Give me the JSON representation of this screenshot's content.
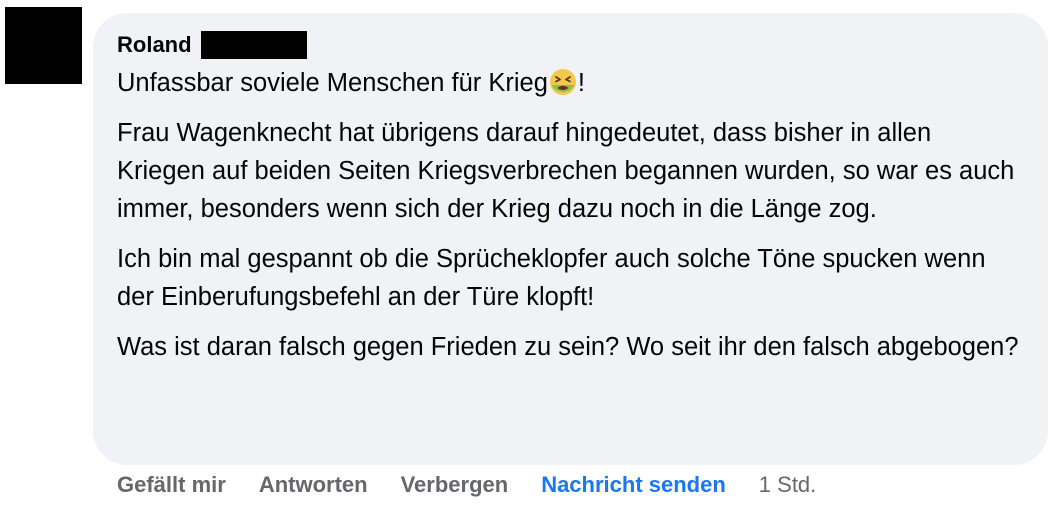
{
  "comment": {
    "author": "Roland",
    "paragraphs": [
      {
        "before_emoji": "Unfassbar soviele Menschen für Krieg",
        "emoji": "nauseated-face-emoji",
        "after_emoji": "!"
      },
      {
        "text": "Frau Wagenknecht hat übrigens darauf hingedeutet, dass bisher in allen Kriegen auf beiden Seiten Kriegsverbrechen begannen wurden, so war es auch immer, besonders wenn sich der Krieg dazu noch in die Länge zog."
      },
      {
        "text": "Ich bin mal gespannt ob die Sprücheklopfer auch solche Töne spucken wenn der Einberufungsbefehl an der Türe klopft!"
      },
      {
        "text": "Was ist daran falsch gegen Frieden zu sein? Wo seit ihr den falsch abgebogen?"
      }
    ]
  },
  "actions": {
    "like": "Gefällt mir",
    "reply": "Antworten",
    "hide": "Verbergen",
    "message": "Nachricht senden",
    "time": "1 Std."
  },
  "colors": {
    "bubble_bg": "#f0f2f5",
    "action_gray": "#65676b",
    "action_blue": "#1877f2",
    "text": "#050505"
  }
}
